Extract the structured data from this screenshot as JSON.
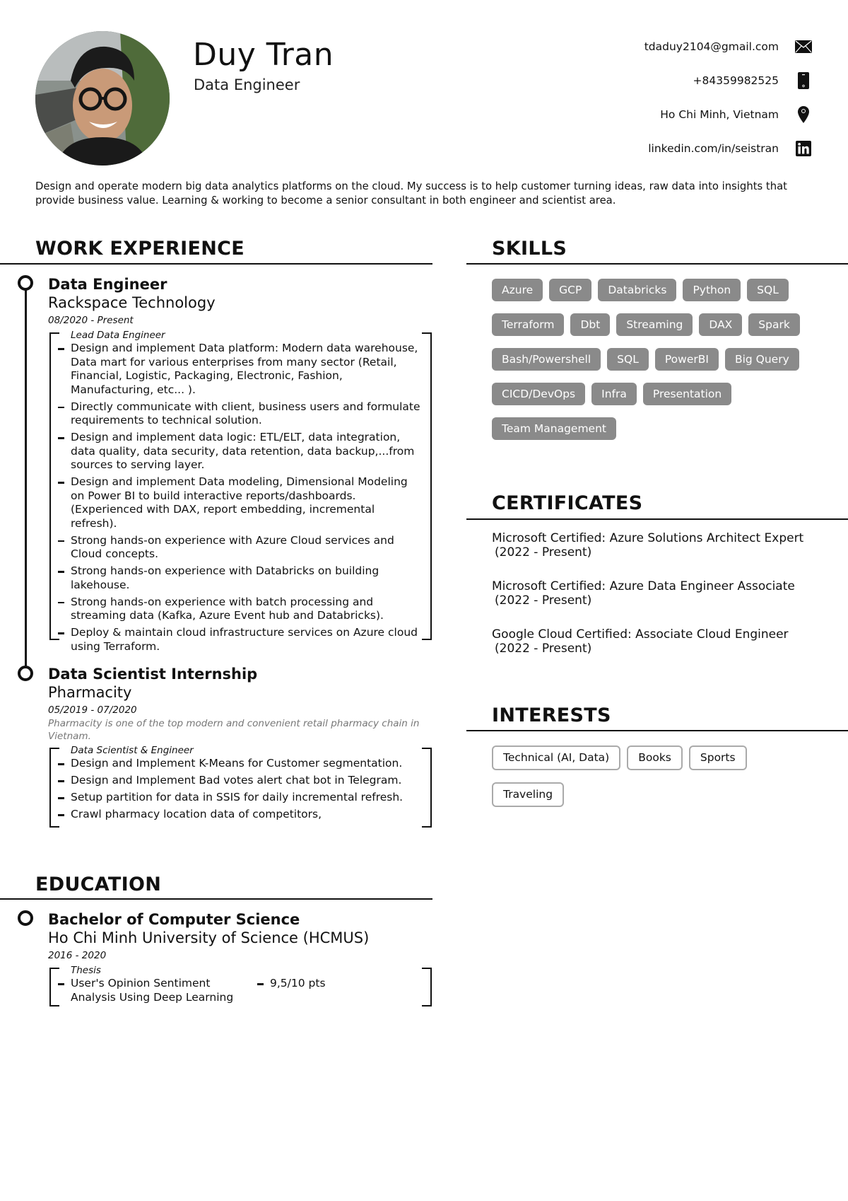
{
  "header": {
    "name": "Duy Tran",
    "role": "Data Engineer",
    "photo_alt": "profile-photo"
  },
  "contacts": [
    {
      "text": "tdaduy2104@gmail.com",
      "icon": "envelope-icon"
    },
    {
      "text": "+84359982525",
      "icon": "phone-icon"
    },
    {
      "text": "Ho Chi Minh, Vietnam",
      "icon": "location-pin-icon"
    },
    {
      "text": "linkedin.com/in/seistran",
      "icon": "linkedin-icon"
    }
  ],
  "summary": "Design and operate modern big data analytics platforms on the cloud. My success is to help customer turning ideas, raw data into insights that provide business value. Learning & working to become a senior consultant in both engineer and scientist area.",
  "work": {
    "title": "WORK EXPERIENCE",
    "jobs": [
      {
        "title": "Data Engineer",
        "company": "Rackspace Technology",
        "date": "08/2020 - Present",
        "position": "Lead Data Engineer",
        "bullets": [
          "Design and implement Data platform: Modern data warehouse, Data mart for various enterprises from many sector (Retail, Financial, Logistic, Packaging, Electronic, Fashion, Manufacturing, etc... ).",
          "Directly communicate with client, business users and formulate requirements to technical solution.",
          "Design and implement data logic: ETL/ELT, data integration, data quality, data security, data retention, data backup,...from sources to serving layer.",
          "Design and implement Data modeling, Dimensional Modeling on Power BI to build interactive reports/dashboards. (Experienced with DAX, report embedding, incremental refresh).",
          "Strong hands-on experience with Azure Cloud services and Cloud concepts.",
          "Strong hands-on experience with Databricks on building lakehouse.",
          "Strong hands-on experience with batch processing and streaming data (Kafka, Azure Event hub and Databricks).",
          "Deploy & maintain cloud infrastructure services on Azure cloud using Terraform."
        ]
      },
      {
        "title": "Data Scientist Internship",
        "company": "Pharmacity",
        "date": "05/2019 - 07/2020",
        "description": "Pharmacity is one of the top modern and convenient retail pharmacy chain in Vietnam.",
        "position": "Data Scientist & Engineer",
        "bullets": [
          "Design and Implement K-Means for Customer segmentation.",
          "Design and Implement Bad votes alert chat bot in Telegram.",
          "Setup partition for data in SSIS for daily incremental refresh.",
          "Crawl pharmacy location data of competitors,"
        ]
      }
    ]
  },
  "education": {
    "title": "EDUCATION",
    "degree": "Bachelor of Computer Science",
    "school": "Ho Chi Minh University of Science (HCMUS)",
    "date": "2016 - 2020",
    "thesis_label": "Thesis",
    "thesis_title": "User's Opinion Sentiment Analysis Using Deep Learning",
    "thesis_score": "9,5/10 pts"
  },
  "skills": {
    "title": "SKILLS",
    "items": [
      "Azure",
      "GCP",
      "Databricks",
      "Python",
      "SQL",
      "Terraform",
      "Dbt",
      "Streaming",
      "DAX",
      "Spark",
      "Bash/Powershell",
      "SQL",
      "PowerBI",
      "Big Query",
      "CICD/DevOps",
      "Infra",
      "Presentation",
      "Team Management"
    ]
  },
  "certificates": {
    "title": "CERTIFICATES",
    "items": [
      {
        "name": "Microsoft Certified: Azure Solutions Architect Expert",
        "date": "(2022 - Present)"
      },
      {
        "name": "Microsoft Certified: Azure Data Engineer Associate",
        "date": "(2022 - Present)"
      },
      {
        "name": "Google Cloud Certified: Associate Cloud Engineer",
        "date": "(2022 - Present)"
      }
    ]
  },
  "interests": {
    "title": "INTERESTS",
    "items": [
      "Technical (AI, Data)",
      "Books",
      "Sports",
      "Traveling"
    ]
  }
}
